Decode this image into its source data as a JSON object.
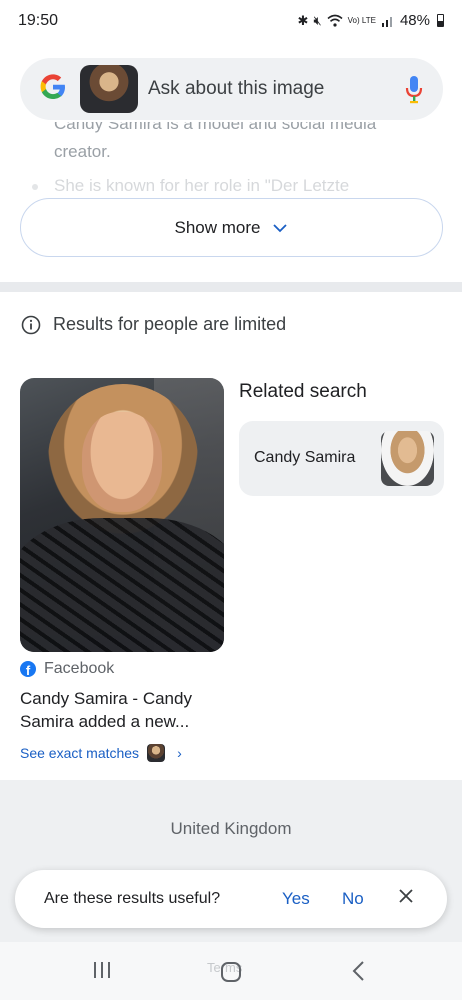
{
  "status_bar": {
    "time": "19:50",
    "battery": "48%",
    "network": "Vo) LTE",
    "icons": [
      "bluetooth-icon",
      "mute-icon",
      "wifi-icon",
      "signal-icon",
      "battery-icon"
    ]
  },
  "search": {
    "placeholder": "Ask about this image",
    "logo": "google-g-icon",
    "mic": "mic-icon"
  },
  "overview": {
    "line1": "Candy Samira is a model and social media",
    "line2": "creator.",
    "bullet": "She is known for her role in \"Der Letzte"
  },
  "show_more": {
    "label": "Show more"
  },
  "notice": {
    "text": "Results for people are limited"
  },
  "result": {
    "source": "Facebook",
    "title": "Candy Samira - Candy Samira added a new...",
    "exact_matches": "See exact matches"
  },
  "related": {
    "heading": "Related search",
    "chip_label": "Candy Samira"
  },
  "footer": {
    "country": "United Kingdom",
    "faded": "Terms"
  },
  "feedback": {
    "question": "Are these results useful?",
    "yes": "Yes",
    "no": "No"
  },
  "colors": {
    "link_blue": "#1a5fc4",
    "pill_bg": "#eff1f3",
    "facebook_blue": "#1877f2"
  }
}
